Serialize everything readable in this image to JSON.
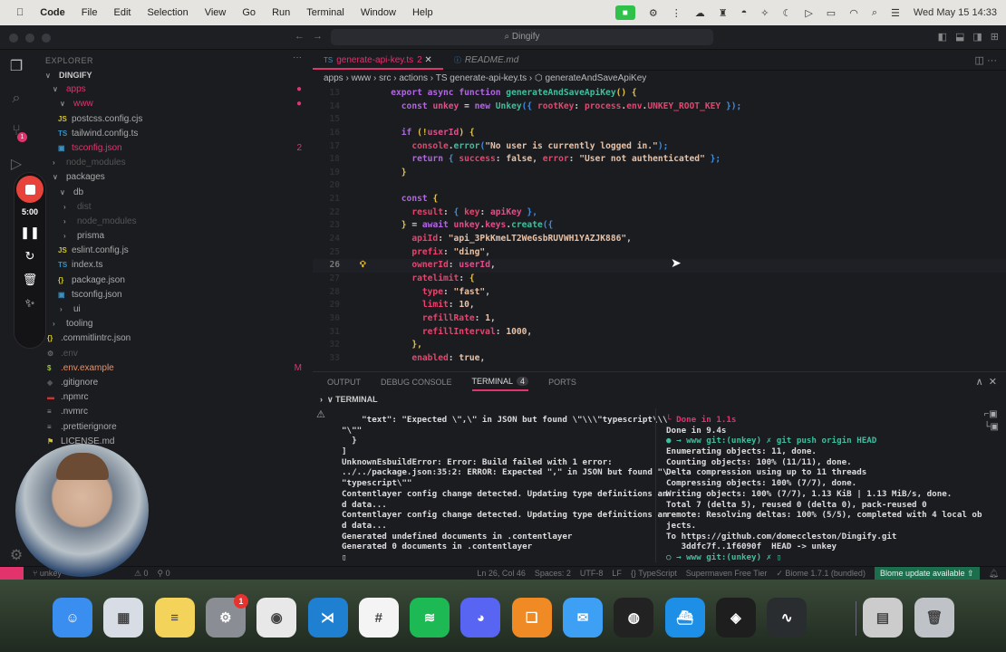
{
  "menubar": {
    "app": "Code",
    "items": [
      "File",
      "Edit",
      "Selection",
      "View",
      "Go",
      "Run",
      "Terminal",
      "Window",
      "Help"
    ],
    "datetime": "Wed May 15  14:33"
  },
  "titlebar": {
    "search": "Dingify"
  },
  "activity": {
    "scm_badge": "1"
  },
  "sidebar": {
    "header": "EXPLORER",
    "tree": [
      {
        "label": "DINGIFY",
        "chev": "∨",
        "indent": 8,
        "cls": "w",
        "bold": true
      },
      {
        "label": "apps",
        "chev": "∨",
        "indent": 16,
        "cls": "red",
        "status": "●"
      },
      {
        "label": "www",
        "chev": "∨",
        "indent": 24,
        "cls": "red",
        "status": "●"
      },
      {
        "label": "postcss.config.cjs",
        "icon": "JS",
        "iconColor": "#d4c42a",
        "indent": 22,
        "cls": ""
      },
      {
        "label": "tailwind.config.ts",
        "icon": "TS",
        "iconColor": "#3c8fbf",
        "indent": 22,
        "cls": ""
      },
      {
        "label": "tsconfig.json",
        "icon": "▣",
        "iconColor": "#3c8fbf",
        "indent": 22,
        "cls": "red",
        "status": "2"
      },
      {
        "label": "node_modules",
        "chev": "›",
        "indent": 16,
        "cls": "dim"
      },
      {
        "label": "packages",
        "chev": "∨",
        "indent": 16,
        "cls": ""
      },
      {
        "label": "db",
        "chev": "∨",
        "indent": 24,
        "cls": ""
      },
      {
        "label": "dist",
        "chev": "›",
        "indent": 28,
        "cls": "dim"
      },
      {
        "label": "node_modules",
        "chev": "›",
        "indent": 28,
        "cls": "dim"
      },
      {
        "label": "prisma",
        "chev": "›",
        "indent": 28,
        "cls": ""
      },
      {
        "label": "eslint.config.js",
        "icon": "JS",
        "iconColor": "#d4c42a",
        "indent": 22,
        "cls": ""
      },
      {
        "label": "index.ts",
        "icon": "TS",
        "iconColor": "#3c8fbf",
        "indent": 22,
        "cls": ""
      },
      {
        "label": "package.json",
        "icon": "{}",
        "iconColor": "#d4c42a",
        "indent": 22,
        "cls": ""
      },
      {
        "label": "tsconfig.json",
        "icon": "▣",
        "iconColor": "#3c8fbf",
        "indent": 22,
        "cls": ""
      },
      {
        "label": "ui",
        "chev": "›",
        "indent": 24,
        "cls": ""
      },
      {
        "label": "tooling",
        "chev": "›",
        "indent": 16,
        "cls": ""
      },
      {
        "label": ".commitlintrc.json",
        "icon": "{}",
        "iconColor": "#d4c42a",
        "indent": 10,
        "cls": ""
      },
      {
        "label": ".env",
        "icon": "⚙",
        "iconColor": "#666",
        "indent": 10,
        "cls": "dim"
      },
      {
        "label": ".env.example",
        "icon": "$",
        "iconColor": "#9bc43a",
        "indent": 10,
        "cls": "orange",
        "status": "M"
      },
      {
        "label": ".gitignore",
        "icon": "◆",
        "iconColor": "#555",
        "indent": 10,
        "cls": ""
      },
      {
        "label": ".npmrc",
        "icon": "▬",
        "iconColor": "#c33",
        "indent": 10,
        "cls": ""
      },
      {
        "label": ".nvmrc",
        "icon": "≡",
        "iconColor": "#999",
        "indent": 10,
        "cls": ""
      },
      {
        "label": ".prettierignore",
        "icon": "≡",
        "iconColor": "#999",
        "indent": 10,
        "cls": ""
      },
      {
        "label": "LICENSE.md",
        "icon": "⚑",
        "iconColor": "#d4c42a",
        "indent": 10,
        "cls": ""
      }
    ]
  },
  "recorder": {
    "time": "5:00"
  },
  "editor": {
    "tabs": [
      {
        "label": "generate-api-key.ts",
        "prefix": "TS",
        "badge": "2",
        "active": true
      },
      {
        "label": "README.md",
        "prefix": "ⓘ",
        "active": false
      }
    ],
    "breadcrumb": "apps › www › src › actions › TS generate-api-key.ts › ⬡ generateAndSaveApiKey",
    "current_line": "26",
    "lines": [
      [
        [
          "export ",
          "k"
        ],
        [
          "async ",
          "k"
        ],
        [
          "function ",
          "k"
        ],
        [
          "generateAndSaveApiKey",
          "f"
        ],
        [
          "()",
          "y"
        ],
        [
          " {",
          "y"
        ]
      ],
      [
        [
          "  const ",
          "k"
        ],
        [
          "unkey ",
          "v"
        ],
        [
          "= ",
          "w"
        ],
        [
          "new ",
          "k"
        ],
        [
          "Unkey",
          "f"
        ],
        [
          "({ ",
          "b"
        ],
        [
          "rootKey",
          "p"
        ],
        [
          ": ",
          "w"
        ],
        [
          "process",
          "p"
        ],
        [
          ".",
          "w"
        ],
        [
          "env",
          "p"
        ],
        [
          ".",
          "w"
        ],
        [
          "UNKEY_ROOT_KEY",
          "p"
        ],
        [
          " });",
          "b"
        ]
      ],
      [],
      [
        [
          "  if ",
          "k"
        ],
        [
          "(!",
          "y"
        ],
        [
          "userId",
          "v"
        ],
        [
          ") {",
          "y"
        ]
      ],
      [
        [
          "    console",
          "p"
        ],
        [
          ".",
          "w"
        ],
        [
          "error",
          "f"
        ],
        [
          "(",
          "b"
        ],
        [
          "\"No user is currently logged in.\"",
          "s"
        ],
        [
          ");",
          "b"
        ]
      ],
      [
        [
          "    return ",
          "k"
        ],
        [
          "{ ",
          "b"
        ],
        [
          "success",
          "p"
        ],
        [
          ": ",
          "w"
        ],
        [
          "false",
          "s"
        ],
        [
          ", ",
          "w"
        ],
        [
          "error",
          "p"
        ],
        [
          ": ",
          "w"
        ],
        [
          "\"User not authenticated\"",
          "s"
        ],
        [
          " };",
          "b"
        ]
      ],
      [
        [
          "  }",
          "y"
        ]
      ],
      [],
      [
        [
          "  const ",
          "k"
        ],
        [
          "{",
          "y"
        ]
      ],
      [
        [
          "    result",
          "p"
        ],
        [
          ": ",
          "w"
        ],
        [
          "{ ",
          "b"
        ],
        [
          "key",
          "p"
        ],
        [
          ": ",
          "w"
        ],
        [
          "apiKey",
          "v"
        ],
        [
          " },",
          "b"
        ]
      ],
      [
        [
          "  } ",
          "y"
        ],
        [
          "= ",
          "w"
        ],
        [
          "await ",
          "k"
        ],
        [
          "unkey",
          "v"
        ],
        [
          ".",
          "w"
        ],
        [
          "keys",
          "v"
        ],
        [
          ".",
          "w"
        ],
        [
          "create",
          "f"
        ],
        [
          "({",
          "b"
        ]
      ],
      [
        [
          "    apiId",
          "p"
        ],
        [
          ": ",
          "w"
        ],
        [
          "\"api_3PkKmeLT2WeGsbRUVWH1YAZJK886\"",
          "s"
        ],
        [
          ",",
          "w"
        ]
      ],
      [
        [
          "    prefix",
          "p"
        ],
        [
          ": ",
          "w"
        ],
        [
          "\"ding\"",
          "s"
        ],
        [
          ",",
          "w"
        ]
      ],
      [
        [
          "    ownerId",
          "p"
        ],
        [
          ": ",
          "w"
        ],
        [
          "userId",
          "v"
        ],
        [
          ",",
          "w"
        ]
      ],
      [
        [
          "    ratelimit",
          "p"
        ],
        [
          ": ",
          "w"
        ],
        [
          "{",
          "y"
        ]
      ],
      [
        [
          "      type",
          "p"
        ],
        [
          ": ",
          "w"
        ],
        [
          "\"fast\"",
          "s"
        ],
        [
          ",",
          "w"
        ]
      ],
      [
        [
          "      limit",
          "p"
        ],
        [
          ": ",
          "w"
        ],
        [
          "10",
          "n"
        ],
        [
          ",",
          "w"
        ]
      ],
      [
        [
          "      refillRate",
          "p"
        ],
        [
          ": ",
          "w"
        ],
        [
          "1",
          "n"
        ],
        [
          ",",
          "w"
        ]
      ],
      [
        [
          "      refillInterval",
          "p"
        ],
        [
          ": ",
          "w"
        ],
        [
          "1000",
          "n"
        ],
        [
          ",",
          "w"
        ]
      ],
      [
        [
          "    },",
          "y"
        ]
      ],
      [
        [
          "    enabled",
          "p"
        ],
        [
          ": ",
          "w"
        ],
        [
          "true",
          "s"
        ],
        [
          ",",
          "w"
        ]
      ]
    ]
  },
  "panel": {
    "tabs": [
      "OUTPUT",
      "DEBUG CONSOLE",
      "TERMINAL",
      "PORTS"
    ],
    "terminal_count": "4",
    "section": "TERMINAL",
    "left": [
      "    \"text\": \"Expected \\\",\\\" in JSON but found \\\"\\\\\\\"typescript\\\\\\",
      "\"\\\"\"",
      "  }",
      "]",
      "UnknownEsbuildError: Error: Build failed with 1 error:",
      "../../package.json:35:2: ERROR: Expected \",\" in JSON but found \"\\",
      "\"typescript\\\"\"",
      "Contentlayer config change detected. Updating type definitions an",
      "d data...",
      "Contentlayer config change detected. Updating type definitions an",
      "d data...",
      "Generated undefined documents in .contentlayer",
      "Generated 0 documents in .contentlayer",
      "▯"
    ],
    "right": [
      {
        "t": "└ Done in 1.1s",
        "c": "pr"
      },
      {
        "t": "Done in 9.4s"
      },
      {
        "t": "● → www git:(unkey) ✗ git push origin HEAD",
        "c": "gr"
      },
      {
        "t": "Enumerating objects: 11, done."
      },
      {
        "t": "Counting objects: 100% (11/11), done."
      },
      {
        "t": "Delta compression using up to 11 threads"
      },
      {
        "t": "Compressing objects: 100% (7/7), done."
      },
      {
        "t": "Writing objects: 100% (7/7), 1.13 KiB | 1.13 MiB/s, done."
      },
      {
        "t": "Total 7 (delta 5), reused 0 (delta 0), pack-reused 0"
      },
      {
        "t": "remote: Resolving deltas: 100% (5/5), completed with 4 local ob"
      },
      {
        "t": "jects."
      },
      {
        "t": "To https://github.com/domeccleston/Dingify.git"
      },
      {
        "t": "   3ddfc7f..1f6090f  HEAD -> unkey"
      },
      {
        "t": "○ → www git:(unkey) ✗ ▯",
        "c": "gr"
      }
    ]
  },
  "statusbar": {
    "branch": "unkey",
    "errors": "⚠ 0",
    "ports": "⚲ 0",
    "items": [
      "Ln 26, Col 46",
      "Spaces: 2",
      "UTF-8",
      "LF",
      "{} TypeScript",
      "Supermaven Free Tier",
      "✓ Biome 1.7.1 (bundled)"
    ],
    "biome_update": "Blome update available ⇧"
  },
  "dock": [
    {
      "name": "finder",
      "color": "#3a8ef0",
      "g": "☺"
    },
    {
      "name": "launchpad",
      "color": "#d8dce4",
      "g": "▦"
    },
    {
      "name": "notes",
      "color": "#f3d35a",
      "g": "≡"
    },
    {
      "name": "system-settings",
      "color": "#8a8d93",
      "g": "⚙",
      "badge": "1"
    },
    {
      "name": "chrome",
      "color": "#e8e8e8",
      "g": "◉"
    },
    {
      "name": "vscode",
      "color": "#1f7fd0",
      "g": "⋊"
    },
    {
      "name": "slack",
      "color": "#f4f4f4",
      "g": "#"
    },
    {
      "name": "spotify",
      "color": "#1db954",
      "g": "≋"
    },
    {
      "name": "discord",
      "color": "#5865f2",
      "g": "◕"
    },
    {
      "name": "books",
      "color": "#f08a24",
      "g": "❑"
    },
    {
      "name": "mail",
      "color": "#3ea0f5",
      "g": "✉"
    },
    {
      "name": "app",
      "color": "#222",
      "g": "◍"
    },
    {
      "name": "docker",
      "color": "#1d8fe6",
      "g": "⛴"
    },
    {
      "name": "figma",
      "color": "#1e1e1e",
      "g": "◈"
    },
    {
      "name": "activity-monitor",
      "color": "#2a2d30",
      "g": "∿"
    },
    {
      "name": "downloads",
      "color": "#ccc",
      "g": "▤"
    },
    {
      "name": "trash",
      "color": "#bfc3c8",
      "g": "🗑"
    }
  ]
}
